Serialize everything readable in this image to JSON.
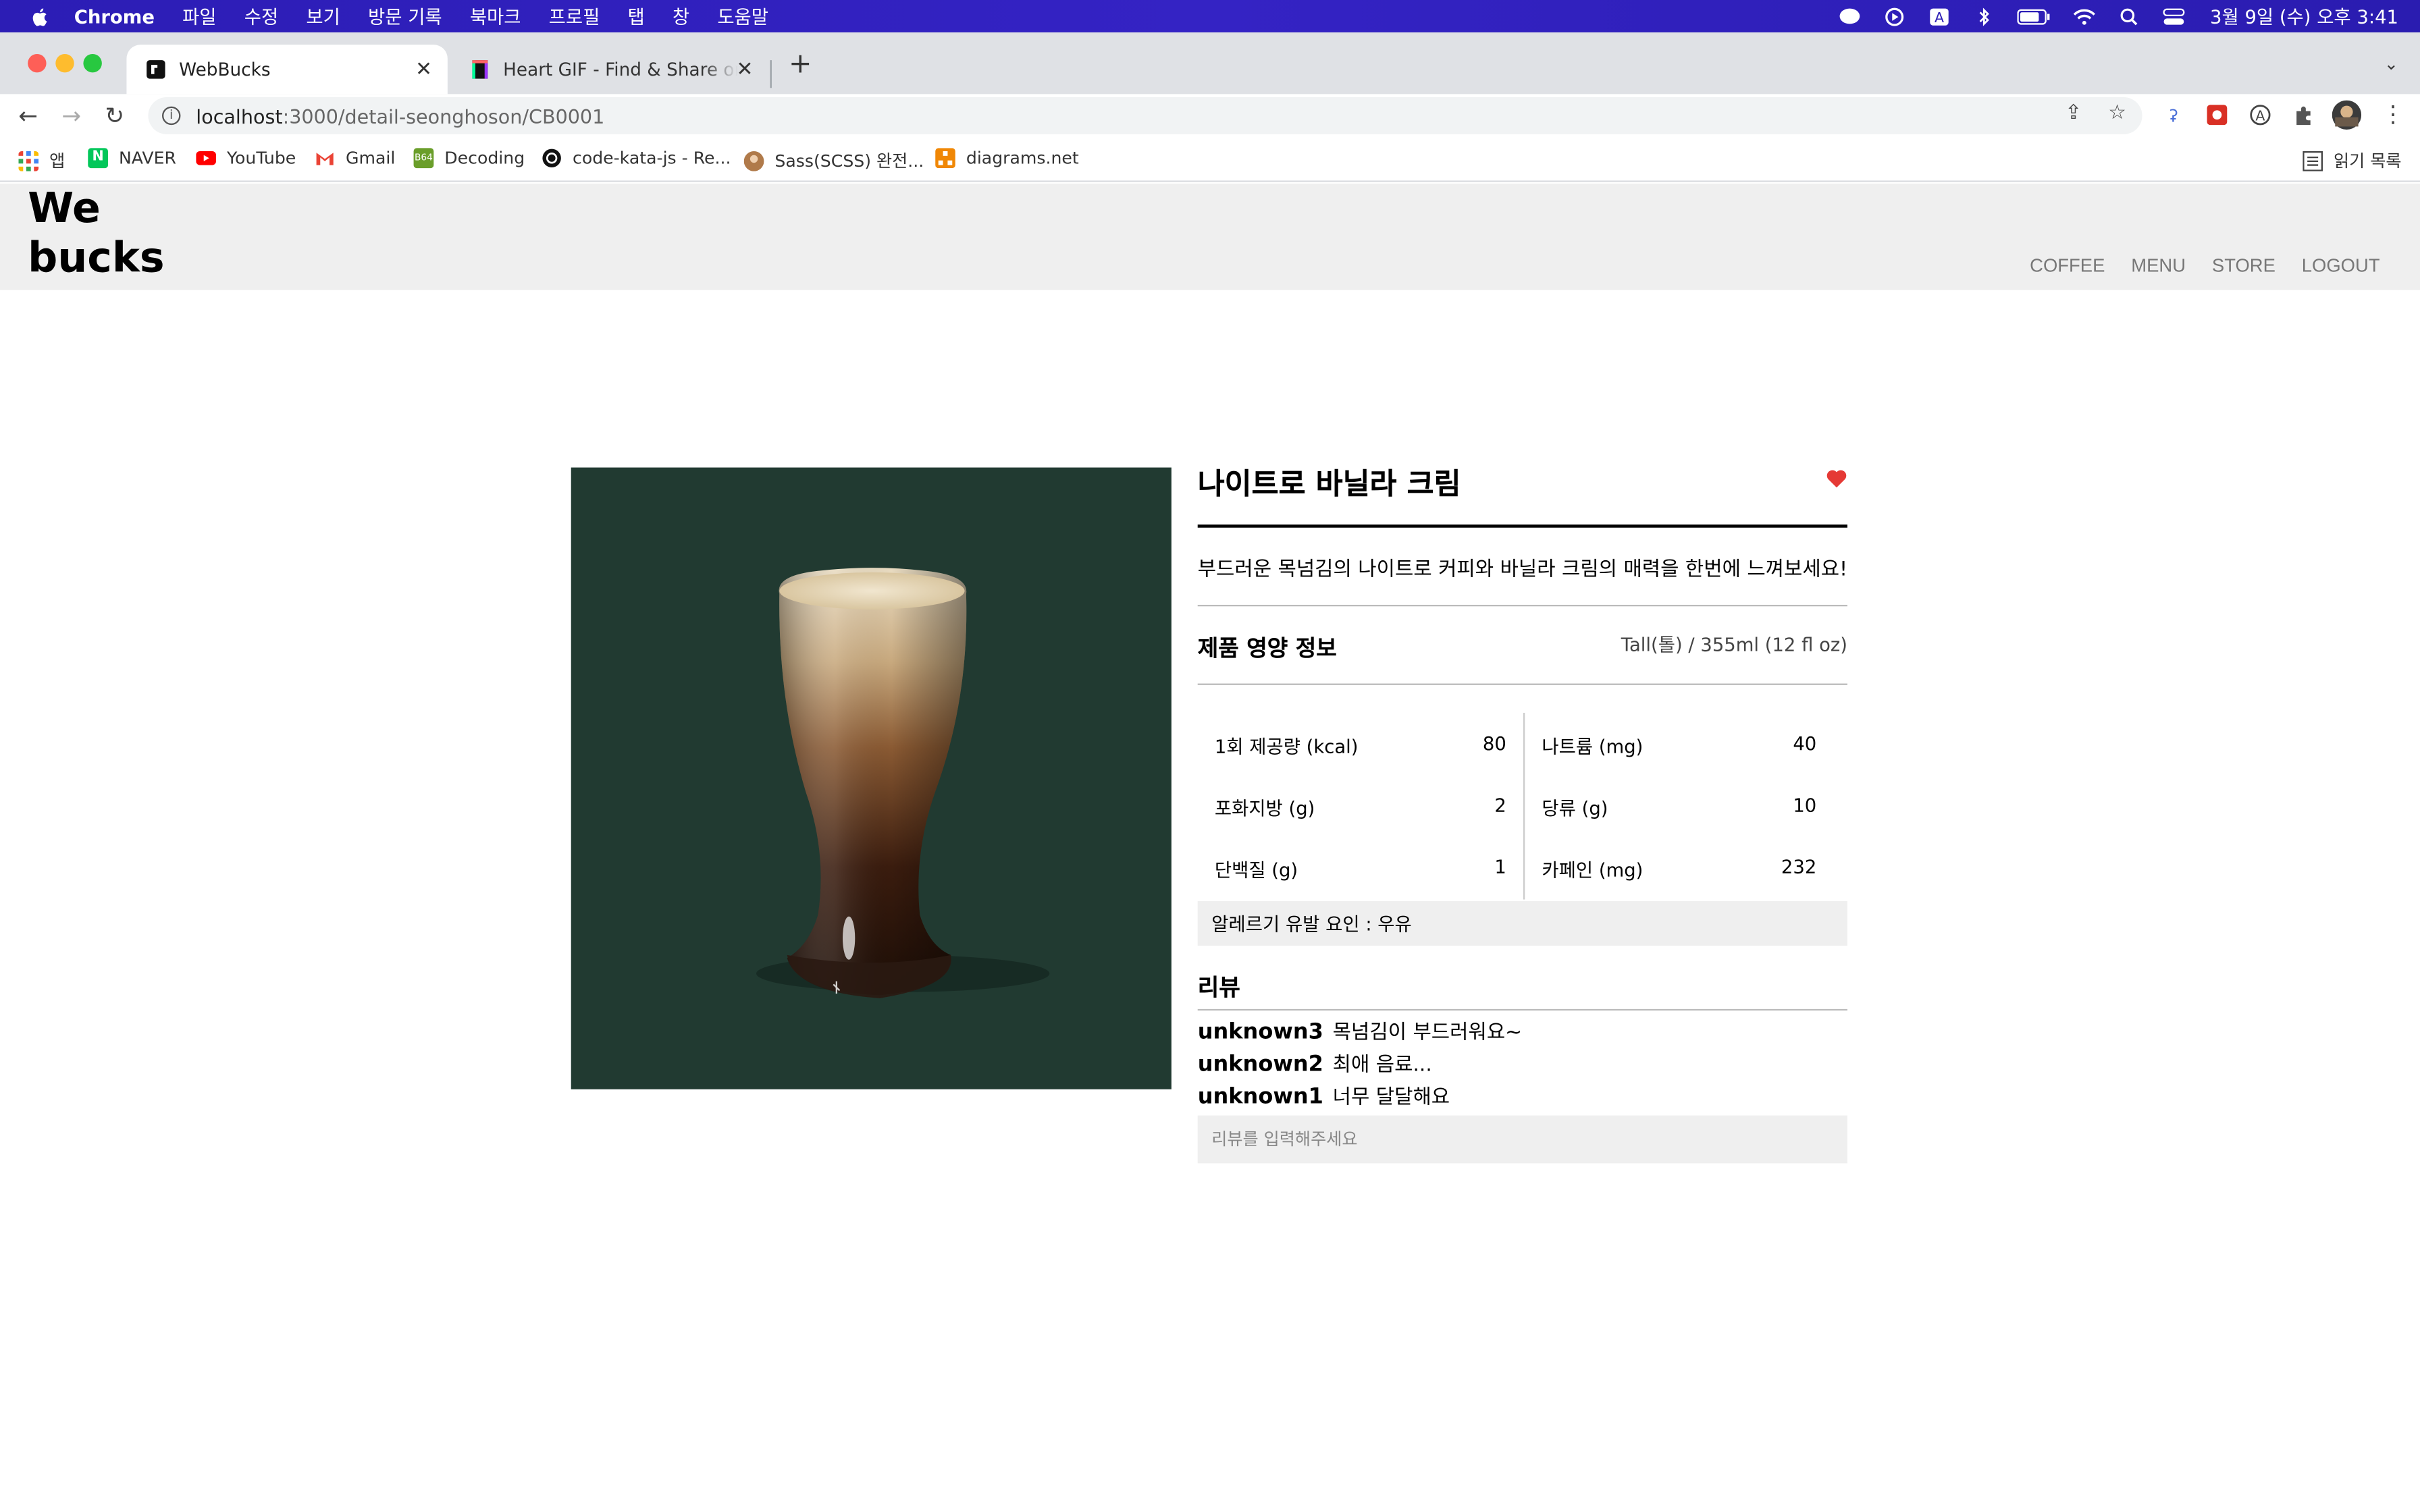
{
  "mac_menubar": {
    "app_name": "Chrome",
    "items": [
      "파일",
      "수정",
      "보기",
      "방문 기록",
      "북마크",
      "프로필",
      "탭",
      "창",
      "도움말"
    ],
    "clock": "3월 9일 (수) 오후 3:41"
  },
  "browser": {
    "tabs": [
      {
        "title": "WebBucks",
        "active": true
      },
      {
        "title": "Heart GIF - Find & Share on GIPHY",
        "active": false
      }
    ],
    "url_host": "localhost",
    "url_path": ":3000/detail-seonghoson/CB0001",
    "bookmarks": [
      {
        "label": "앱",
        "icon": "apps-grid-icon",
        "color": "#e94235"
      },
      {
        "label": "NAVER",
        "icon": "naver-icon",
        "color": "#03c75a"
      },
      {
        "label": "YouTube",
        "icon": "youtube-icon",
        "color": "#ff0000"
      },
      {
        "label": "Gmail",
        "icon": "gmail-icon",
        "color": "#ea4335"
      },
      {
        "label": "Decoding",
        "icon": "decoding-icon",
        "color": "#6a9e2a"
      },
      {
        "label": "code-kata-js - Re...",
        "icon": "github-icon",
        "color": "#111111"
      },
      {
        "label": "Sass(SCSS) 완전...",
        "icon": "profile-avatar-icon",
        "color": "#b07a4a"
      },
      {
        "label": "diagrams.net",
        "icon": "diagrams-icon",
        "color": "#f08705"
      }
    ],
    "reading_list": "읽기 목록"
  },
  "site": {
    "logo_line1": "We",
    "logo_line2": "bucks",
    "nav": [
      "COFFEE",
      "MENU",
      "STORE",
      "LOGOUT"
    ]
  },
  "product": {
    "name": "나이트로 바닐라 크림",
    "description": "부드러운 목넘김의 나이트로 커피와 바닐라 크림의 매력을 한번에 느껴보세요!",
    "liked": true,
    "heart_color": "#e53935",
    "image_bg": "#213a31",
    "nutrition_title": "제품 영양 정보",
    "serving_size": "Tall(톨) / 355ml (12 fl oz)",
    "nutrition_left": [
      {
        "label": "1회 제공량 (kcal)",
        "value": "80"
      },
      {
        "label": "포화지방 (g)",
        "value": "2"
      },
      {
        "label": "단백질 (g)",
        "value": "1"
      }
    ],
    "nutrition_right": [
      {
        "label": "나트륨 (mg)",
        "value": "40"
      },
      {
        "label": "당류 (g)",
        "value": "10"
      },
      {
        "label": "카페인 (mg)",
        "value": "232"
      }
    ],
    "allergy": "알레르기 유발 요인 : 우유",
    "review_title": "리뷰",
    "reviews": [
      {
        "user": "unknown3",
        "text": "목넘김이 부드러워요~"
      },
      {
        "user": "unknown2",
        "text": "최애 음료..."
      },
      {
        "user": "unknown1",
        "text": "너무 달달해요"
      }
    ],
    "review_placeholder": "리뷰를 입력해주세요"
  }
}
